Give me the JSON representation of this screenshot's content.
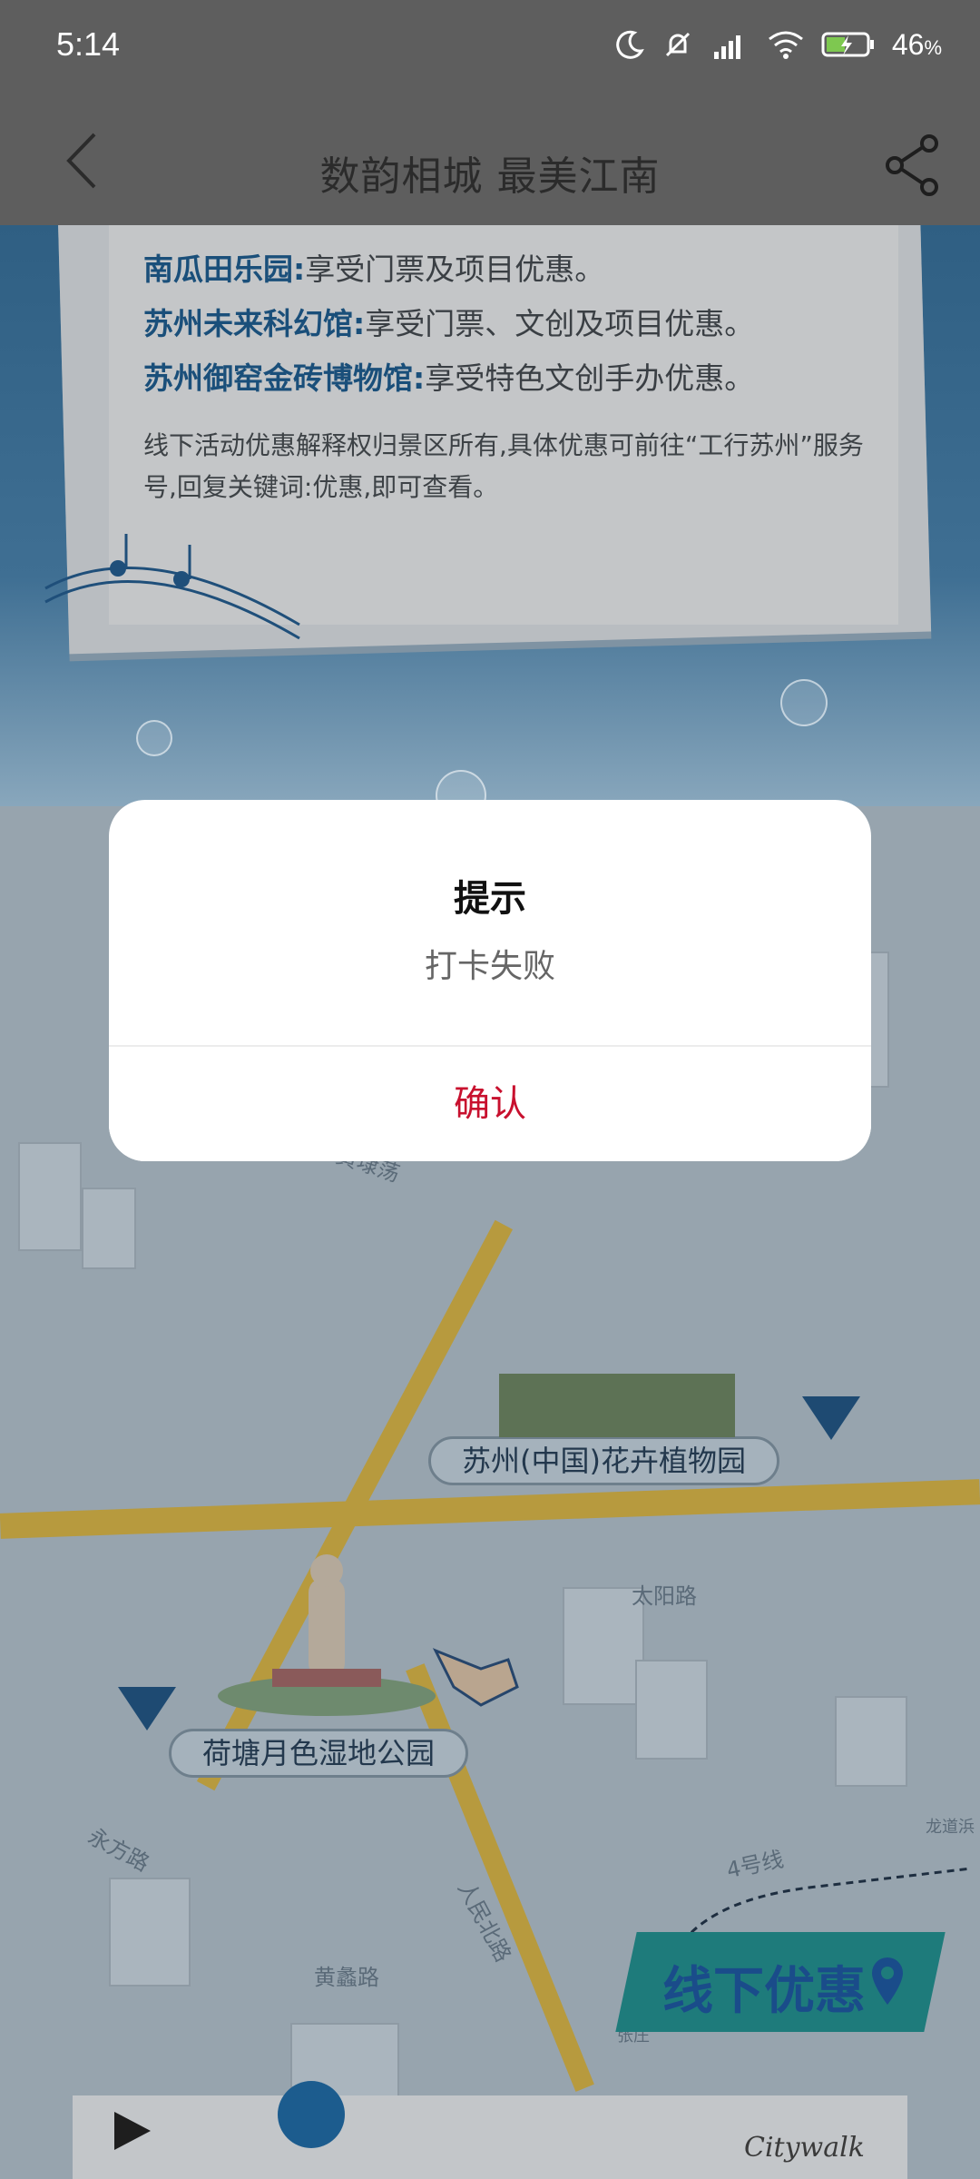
{
  "status_bar": {
    "time": "5:14",
    "battery": "46",
    "battery_unit": "%",
    "icons": [
      "moon-icon",
      "silent-bell-icon",
      "hd-signal-icon",
      "wifi-icon",
      "battery-charging-icon"
    ]
  },
  "header": {
    "title": "数韵相城 最美江南",
    "back_icon": "chevron-left-icon",
    "share_icon": "share-icon"
  },
  "notice": {
    "items": [
      {
        "name": "南瓜田乐园:",
        "desc": "享受门票及项目优惠。"
      },
      {
        "name": "苏州未来科幻馆:",
        "desc": "享受门票、文创及项目优惠。"
      },
      {
        "name": "苏州御窑金砖博物馆:",
        "desc": "享受特色文创手办优惠。"
      }
    ],
    "footnote": "线下活动优惠解释权归景区所有,具体优惠可前往“工行苏州”服务号,回复关键词:优惠,即可查看。"
  },
  "map": {
    "poi_botanical": "苏州(中国)花卉植物园",
    "poi_wetland": "荷塘月色湿地公园",
    "road_taiyang": "太阳路",
    "road_huangqiao": "黄埭荡",
    "road_yongfang": "永方路",
    "road_renmin": "人民北路",
    "road_huangli": "黄蠡路",
    "metro_line": "4号线",
    "station_longdao": "龙道浜",
    "station_zhangzhuang": "张庄"
  },
  "offline_badge": "线下优惠",
  "bottom_brand": "Citywalk",
  "dialog": {
    "title": "提示",
    "message": "打卡失败",
    "confirm": "确认"
  },
  "colors": {
    "confirm": "#c8102e",
    "overlay": "#5e5e5e"
  }
}
